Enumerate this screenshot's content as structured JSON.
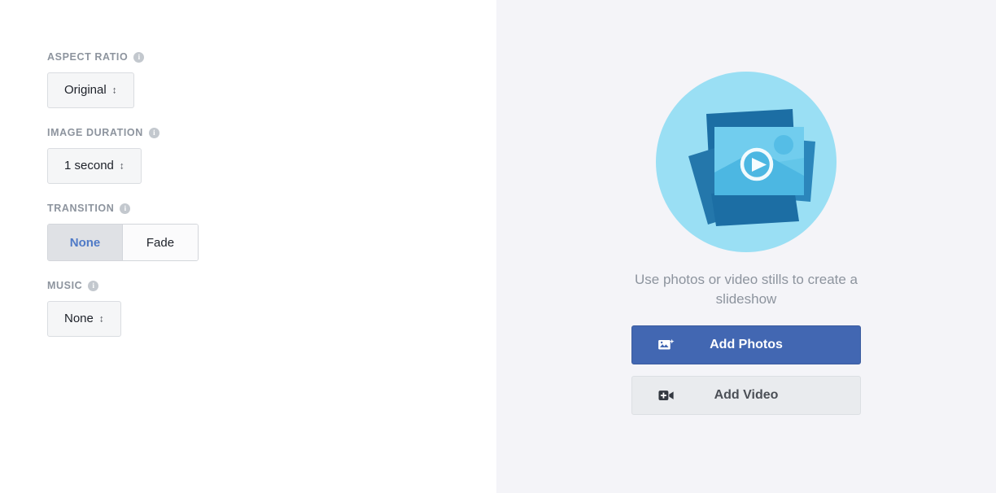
{
  "settings": {
    "fields": [
      {
        "key": "aspect-ratio",
        "label": "ASPECT RATIO",
        "info_icon": "info-icon",
        "control": "select",
        "value": "Original",
        "caret": "↕"
      },
      {
        "key": "image-duration",
        "label": "IMAGE DURATION",
        "info_icon": "info-icon",
        "control": "select",
        "value": "1 second",
        "caret": "↕"
      },
      {
        "key": "transition",
        "label": "TRANSITION",
        "info_icon": "info-icon",
        "control": "segmented",
        "options": [
          "None",
          "Fade"
        ],
        "selected": "None"
      },
      {
        "key": "music",
        "label": "MUSIC",
        "info_icon": "info-icon",
        "control": "select",
        "value": "None",
        "caret": "↕"
      }
    ]
  },
  "preview": {
    "illustration_name": "slideshow-photos-video-illustration",
    "caption": "Use photos or video stills to create a slideshow",
    "buttons": [
      {
        "key": "add-photos",
        "label": "Add Photos",
        "icon": "add-photo-icon",
        "style": "primary"
      },
      {
        "key": "add-video",
        "label": "Add Video",
        "icon": "add-video-icon",
        "style": "secondary"
      }
    ]
  },
  "colors": {
    "panel_background": "#f4f4f8",
    "primary_button": "#4267b2",
    "secondary_button": "#e9ebee",
    "label_text": "#8d949e",
    "selected_segment_text": "#4f7ac7",
    "selected_segment_background": "#dfe1e5",
    "illustration_circle": "#9adff4",
    "illustration_card_dark": "#1c6ea4",
    "illustration_card_mid": "#2e8fc4",
    "illustration_card_light": "#5ec3e8"
  }
}
